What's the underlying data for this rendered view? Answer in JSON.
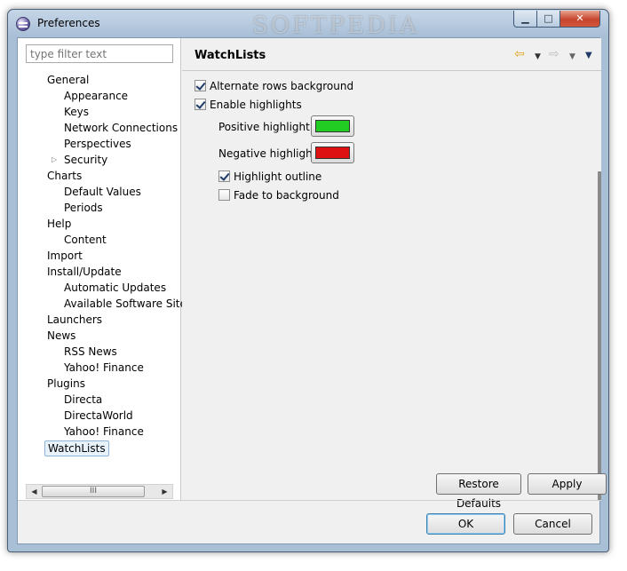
{
  "window": {
    "title": "Preferences",
    "watermark": "SOFTPEDIA",
    "minimize_glyph": "▁",
    "maximize_glyph": "□",
    "close_glyph": "✕"
  },
  "filter": {
    "placeholder": "type filter text"
  },
  "tree": [
    {
      "label": "General",
      "level": 0
    },
    {
      "label": "Appearance",
      "level": 1
    },
    {
      "label": "Keys",
      "level": 1
    },
    {
      "label": "Network Connections",
      "level": 1
    },
    {
      "label": "Perspectives",
      "level": 1
    },
    {
      "label": "Security",
      "level": 1,
      "expander": "▷"
    },
    {
      "label": "Charts",
      "level": 0
    },
    {
      "label": "Default Values",
      "level": 1
    },
    {
      "label": "Periods",
      "level": 1
    },
    {
      "label": "Help",
      "level": 0
    },
    {
      "label": "Content",
      "level": 1
    },
    {
      "label": "Import",
      "level": 0
    },
    {
      "label": "Install/Update",
      "level": 0
    },
    {
      "label": "Automatic Updates",
      "level": 1
    },
    {
      "label": "Available Software Sites",
      "level": 1
    },
    {
      "label": "Launchers",
      "level": 0
    },
    {
      "label": "News",
      "level": 0
    },
    {
      "label": "RSS News",
      "level": 1
    },
    {
      "label": "Yahoo! Finance",
      "level": 1
    },
    {
      "label": "Plugins",
      "level": 0
    },
    {
      "label": "Directa",
      "level": 1
    },
    {
      "label": "DirectaWorld",
      "level": 1
    },
    {
      "label": "Yahoo! Finance",
      "level": 1
    },
    {
      "label": "WatchLists",
      "level": 0,
      "selected": true
    }
  ],
  "scrollbar": {
    "left_arrow": "◀",
    "right_arrow": "▶",
    "thumb_grip": "III"
  },
  "page": {
    "title": "WatchLists",
    "nav_back_icon": "⇦",
    "nav_dropdown": "▼",
    "nav_forward_icon": "⇨",
    "view_menu_icon": "▼",
    "alternate_rows": {
      "label": "Alternate rows background",
      "checked": true
    },
    "enable_highlights": {
      "label": "Enable highlights",
      "checked": true
    },
    "positive_highlight": {
      "label": "Positive highlight",
      "color": "#22cc22"
    },
    "negative_highlight": {
      "label": "Negative highlight",
      "color": "#dd1111"
    },
    "highlight_outline": {
      "label": "Highlight outline",
      "checked": true
    },
    "fade_to_background": {
      "label": "Fade to background",
      "checked": false
    }
  },
  "buttons": {
    "restore_defaults": "Restore Defaults",
    "apply": "Apply",
    "ok": "OK",
    "cancel": "Cancel"
  }
}
